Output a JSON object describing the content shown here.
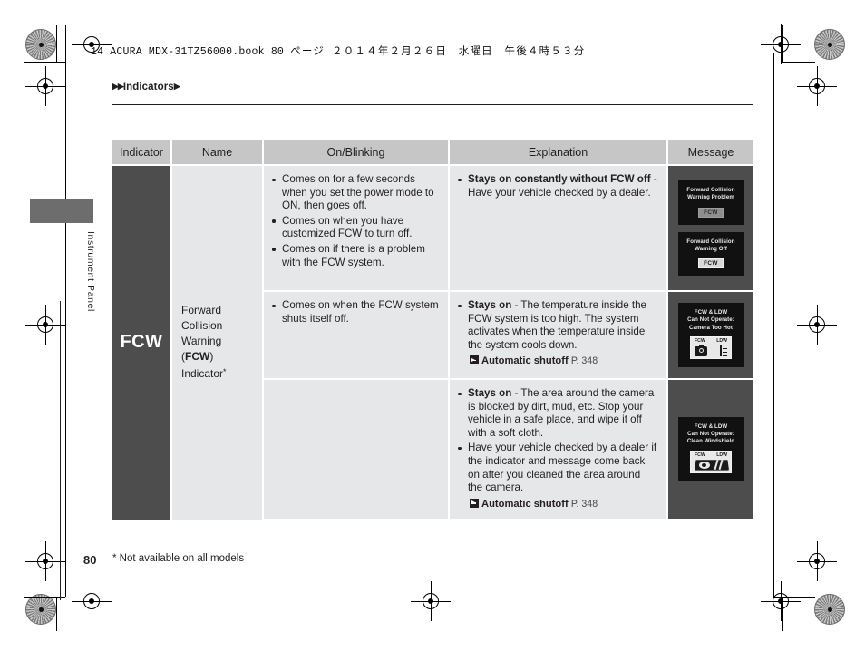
{
  "imprint": {
    "latin": "14 ACURA MDX-31TZ56000.book   80 ",
    "jp_page": "ページ",
    "jp_date": "２０１４年２月２６日　水曜日　午後４時５３分"
  },
  "breadcrumb": {
    "marker_left": "▶▶",
    "label": "Indicators",
    "marker_right": "▶"
  },
  "sidebar": {
    "tab_label": "Instrument Panel"
  },
  "table": {
    "headers": [
      "Indicator",
      "Name",
      "On/Blinking",
      "Explanation",
      "Message"
    ],
    "indicator": {
      "glyph": "FCW"
    },
    "name": {
      "line1": "Forward",
      "line2": "Collision",
      "line3_prefix": "Warning (",
      "line3_bold": "FCW",
      "line3_suffix": ")",
      "line4": "Indicator",
      "footnote_mark": "*"
    },
    "rows": [
      {
        "on_blinking": [
          "Comes on for a few seconds when you set the power mode to ON, then goes off.",
          "Comes on when you have customized FCW to turn off.",
          "Comes on if there is a problem with the FCW system."
        ],
        "explanation": [
          {
            "bold": "Stays on constantly without FCW off",
            "text": " - Have your vehicle checked by a dealer."
          }
        ],
        "xref": null,
        "messages": [
          {
            "lines": [
              "Forward Collision",
              "Warning Problem"
            ],
            "badge": "FCW",
            "badge_style": "dim",
            "icon": null
          },
          {
            "lines": [
              "Forward Collision",
              "Warning Off"
            ],
            "badge": "FCW",
            "badge_style": "bright",
            "icon": null
          }
        ]
      },
      {
        "on_blinking": [
          "Comes on when the FCW system shuts itself off."
        ],
        "explanation": [
          {
            "bold": "Stays on",
            "text": " - The temperature inside the FCW system is too high. The system activates when the temperature inside the system cools down."
          }
        ],
        "xref": {
          "title": "Automatic shutoff",
          "page": "P. 348"
        },
        "messages": [
          {
            "lines": [
              "FCW & LDW",
              "Can Not Operate:",
              "Camera Too Hot"
            ],
            "badge": null,
            "icon": "camera-ldw",
            "icon_labels": [
              "FCW",
              "LDW"
            ]
          }
        ]
      },
      {
        "on_blinking": [],
        "explanation": [
          {
            "bold": "Stays on",
            "text": " - The area around the camera is blocked by dirt, mud, etc. Stop your vehicle in a safe place, and wipe it off with a soft cloth."
          },
          {
            "bold": "",
            "text": "Have your vehicle checked by a dealer if the indicator and message come back on after you cleaned the area around the camera."
          }
        ],
        "xref": {
          "title": "Automatic shutoff",
          "page": "P. 348"
        },
        "messages": [
          {
            "lines": [
              "FCW & LDW",
              "Can Not Operate:",
              "Clean Windshield"
            ],
            "badge": null,
            "icon": "windshield-ldw",
            "icon_labels": [
              "FCW",
              "LDW"
            ]
          }
        ]
      }
    ]
  },
  "footer": {
    "page_number": "80",
    "footnote": "* Not available on all models"
  },
  "colors": {
    "header_gray": "#c6c6c6",
    "cell_gray": "#e6e7e8",
    "dark_gray": "#4d4d4d",
    "mfu_black": "#111111",
    "ink": "#231f20"
  }
}
